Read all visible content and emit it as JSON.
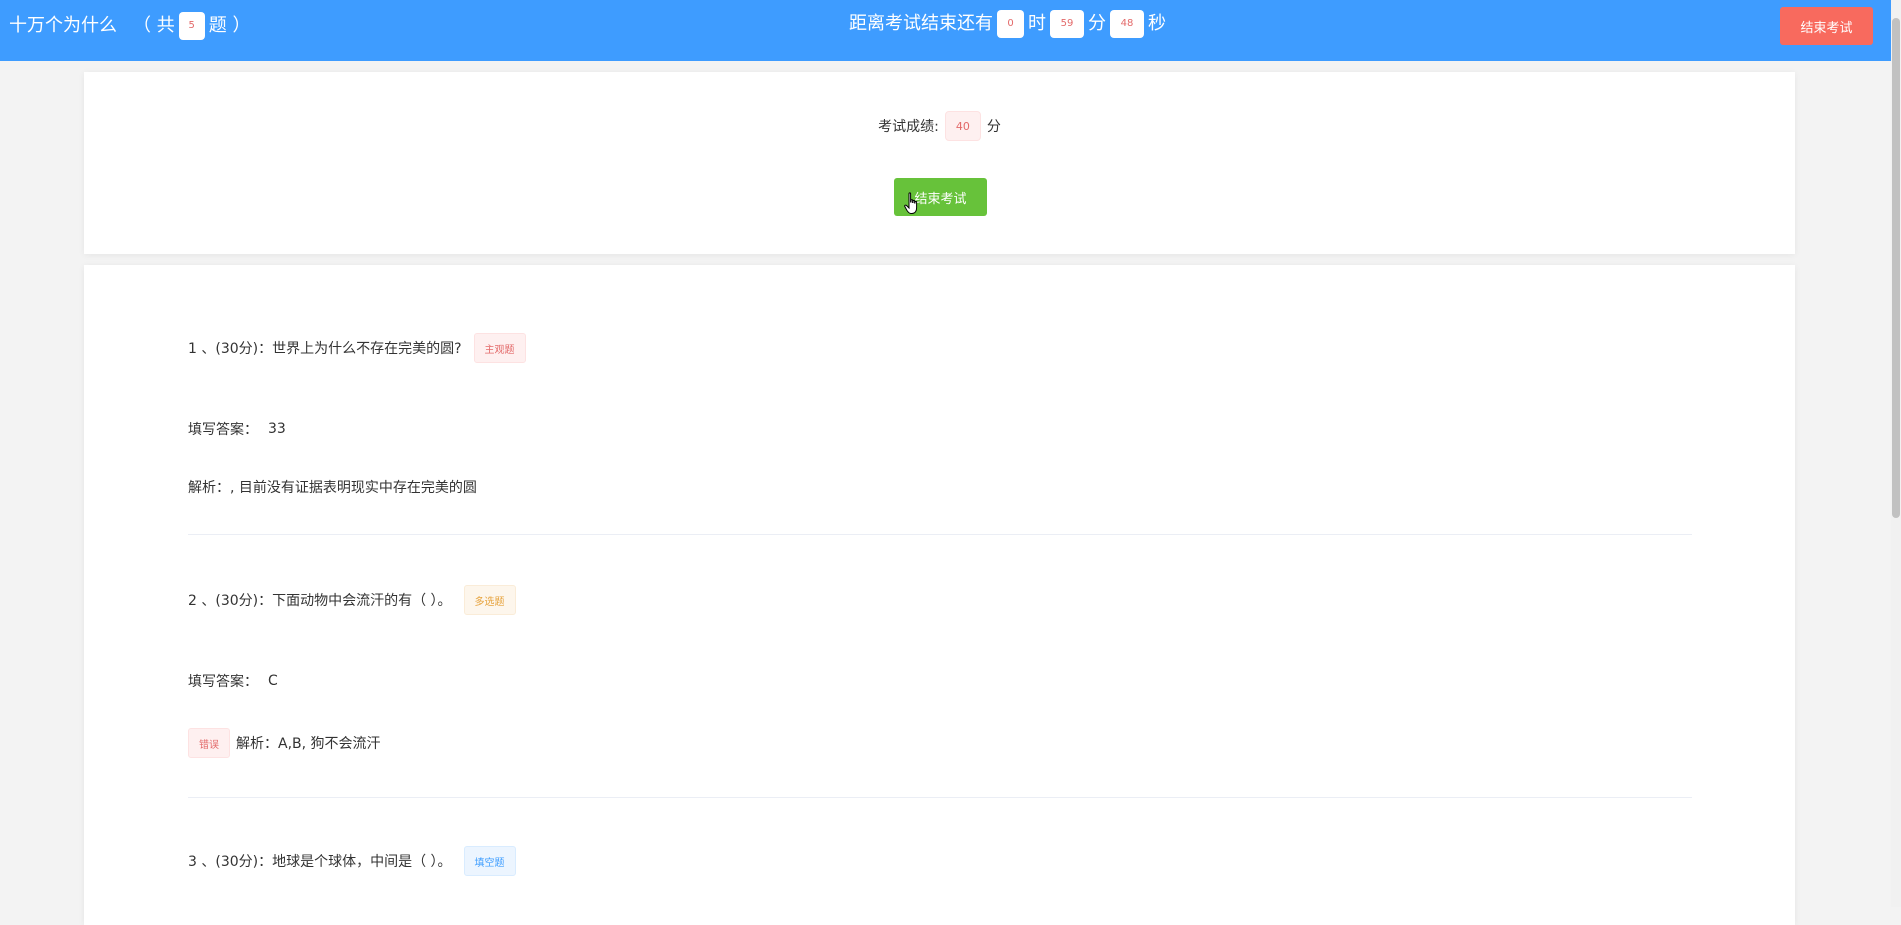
{
  "header": {
    "title": "十万个为什么",
    "count_prefix": "（ 共",
    "count": "5",
    "count_suffix": "题 ）",
    "timer_label": "距离考试结束还有",
    "hours": "0",
    "hours_unit": "时",
    "minutes": "59",
    "minutes_unit": "分",
    "seconds": "48",
    "seconds_unit": "秒",
    "end_button": "结束考试"
  },
  "score": {
    "label": "考试成绩:",
    "value": "40",
    "unit": "分",
    "button": "结束考试"
  },
  "questions": [
    {
      "title": "1 、(30分)：世界上为什么不存在完美的圆?",
      "tag": "主观题",
      "answer_label": "填写答案：",
      "answer": "33",
      "analysis": "解析：, 目前没有证据表明现实中存在完美的圆"
    },
    {
      "title": "2 、(30分)：下面动物中会流汗的有（ ）。",
      "tag": "多选题",
      "answer_label": "填写答案：",
      "answer": "C",
      "result_tag": "错误",
      "analysis": "解析：A,B, 狗不会流汗"
    },
    {
      "title": "3 、(30分)：地球是个球体，中间是（ ）。",
      "tag": "填空题"
    }
  ],
  "colors": {
    "header_bg": "#3e9cff",
    "end_button_bg": "#f86a5e",
    "green_button_bg": "#67c23a"
  }
}
